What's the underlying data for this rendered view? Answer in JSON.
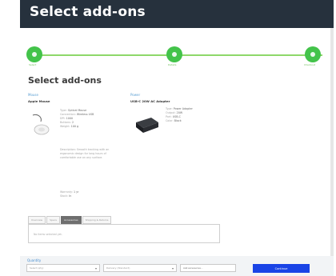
{
  "window": {
    "title": "Select add-ons"
  },
  "steps": [
    {
      "label": "Select"
    },
    {
      "label": "Details"
    },
    {
      "label": "Checkout"
    }
  ],
  "section_heading": "Select add-ons",
  "products": [
    {
      "category": "Mouse",
      "name": "Apple Mouse",
      "specs": [
        {
          "k": "Type",
          "v": "Optical Mouse"
        },
        {
          "k": "Connection",
          "v": "Wireless USB"
        },
        {
          "k": "DPI",
          "v": "1000"
        },
        {
          "k": "Buttons",
          "v": "2"
        },
        {
          "k": "Weight",
          "v": "100 g"
        }
      ],
      "description": "Description: Smooth tracking with an ergonomic design for long hours of comfortable use on any surface.",
      "extra": [
        {
          "k": "Warranty",
          "v": "1 yr"
        },
        {
          "k": "Stock",
          "v": "In"
        }
      ]
    },
    {
      "category": "Power",
      "name": "USB-C 20W AC Adapter",
      "specs": [
        {
          "k": "Type",
          "v": "Power Adapter"
        },
        {
          "k": "Output",
          "v": "20W"
        },
        {
          "k": "Port",
          "v": "USB-C"
        },
        {
          "k": "Color",
          "v": "Black"
        }
      ]
    }
  ],
  "tabs": [
    {
      "label": "Overview",
      "active": false
    },
    {
      "label": "Specs",
      "active": false
    },
    {
      "label": "Accessories",
      "active": true
    },
    {
      "label": "Shipping & Returns",
      "active": false
    }
  ],
  "tab_body_text": "No items selected yet.",
  "bottom": {
    "label": "Quantity",
    "selects": [
      {
        "value": "Select (qty)"
      },
      {
        "value": "Delivery (Standard)"
      }
    ],
    "search_placeholder": "Add accessories...",
    "cta_label": "Continue"
  },
  "colors": {
    "title_bar": "#26313d",
    "step": "#43c34a",
    "accent": "#1a44e6",
    "link": "#5a9fd3"
  }
}
